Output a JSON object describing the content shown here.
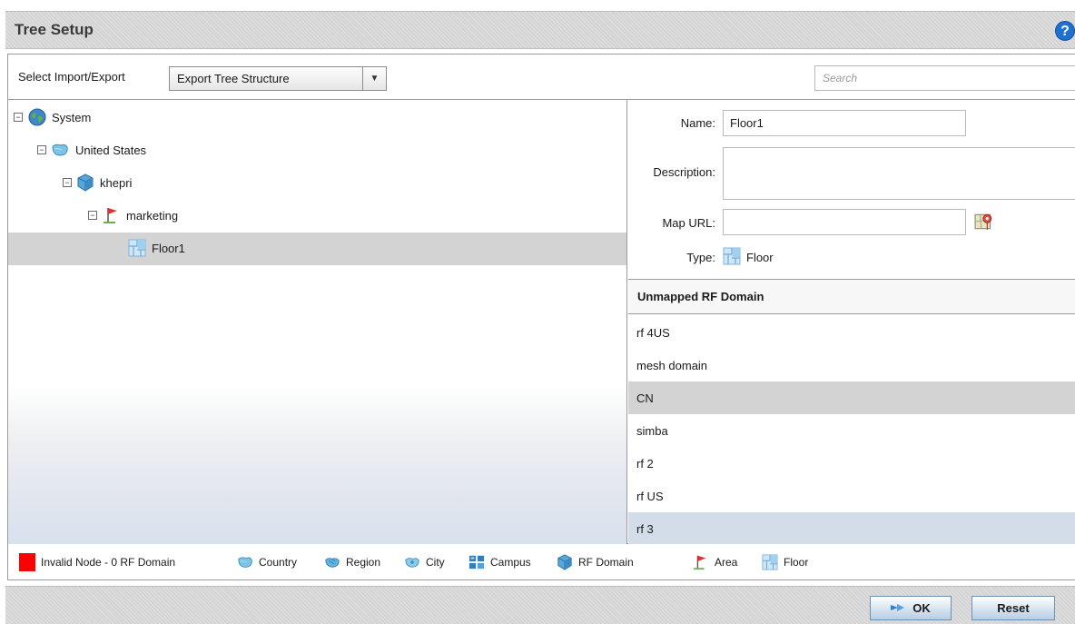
{
  "header": {
    "title": "Tree Setup",
    "help_icon": "help-icon"
  },
  "toolbar": {
    "import_export_label": "Select Import/Export",
    "import_export_value": "Export Tree Structure",
    "search_placeholder": "Search"
  },
  "tree": {
    "nodes": [
      {
        "label": "System",
        "icon": "globe-icon",
        "depth": 0,
        "expanded": true
      },
      {
        "label": "United States",
        "icon": "country-icon",
        "depth": 1,
        "expanded": true
      },
      {
        "label": "khepri",
        "icon": "rf-domain-icon",
        "depth": 2,
        "expanded": true
      },
      {
        "label": "marketing",
        "icon": "area-flag-icon",
        "depth": 3,
        "expanded": true
      },
      {
        "label": "Floor1",
        "icon": "floor-icon",
        "depth": 4,
        "selected": true
      }
    ]
  },
  "details": {
    "name_label": "Name:",
    "name_value": "Floor1",
    "description_label": "Description:",
    "description_value": "",
    "map_url_label": "Map URL:",
    "map_url_value": "",
    "type_label": "Type:",
    "type_value": "Floor"
  },
  "rf_domains": {
    "header": "Unmapped RF Domain",
    "items": [
      "rf 4US",
      "mesh domain",
      "CN",
      "simba",
      "rf 2",
      "rf US",
      "rf 3"
    ]
  },
  "legend": {
    "items": [
      {
        "label": "Invalid Node - 0 RF Domain",
        "icon": "invalid-node-icon",
        "color": "#ff0000"
      },
      {
        "label": "Country",
        "icon": "country-icon"
      },
      {
        "label": "Region",
        "icon": "region-icon"
      },
      {
        "label": "City",
        "icon": "city-icon"
      },
      {
        "label": "Campus",
        "icon": "campus-icon"
      },
      {
        "label": "RF Domain",
        "icon": "rf-domain-icon"
      },
      {
        "label": "Area",
        "icon": "area-flag-icon"
      },
      {
        "label": "Floor",
        "icon": "floor-icon"
      }
    ]
  },
  "footer": {
    "ok_label": "OK",
    "reset_label": "Reset"
  },
  "colors": {
    "selection_gray": "#d3d3d3",
    "selection_blue": "#d2dde9",
    "accent_blue": "#1f6fd0"
  }
}
